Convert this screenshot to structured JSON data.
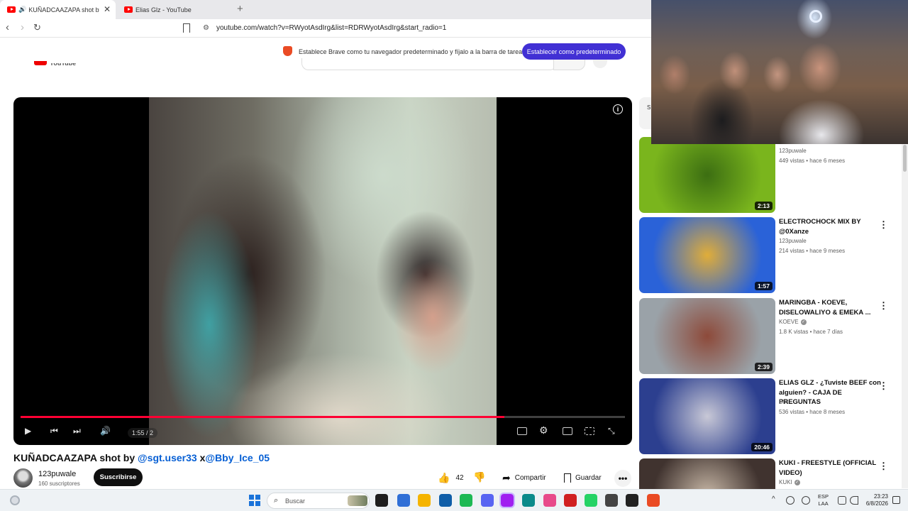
{
  "browser": {
    "tabs": [
      {
        "label": "KUÑADCAAZAPA shot by @s"
      },
      {
        "label": "Elias Glz - YouTube"
      }
    ],
    "close_tab_glyph": "✕",
    "new_tab_glyph": "+",
    "url": "youtube.com/watch?v=RWyotAsdIrg&list=RDRWyotAsdIrg&start_radio=1",
    "nav": {
      "back_glyph": "‹",
      "forward_glyph": "›",
      "reload_glyph": "↻"
    }
  },
  "banner": {
    "text": "Establece Brave como tu navegador predeterminado y fíjalo a la barra de tareas",
    "button_label": "Establecer como predeterminado"
  },
  "masthead": {
    "logo_partial_text": "YouTube"
  },
  "player": {
    "time_display": "1:55 / 2",
    "progress_fraction": 0.8,
    "info_glyph": "i",
    "controls": {
      "play": "▶",
      "prev": "⏮",
      "next": "⏭",
      "volume": "🔊"
    }
  },
  "video": {
    "title_prefix": "KUÑADCAAZAPA shot by ",
    "mention1": "@sgt.user33",
    "title_mid": " x",
    "mention2": "@Bby_Ice_05",
    "channel": "123puwale",
    "subscribers": "160 suscriptores",
    "subscribe_label": "Suscribirse",
    "likes": "42",
    "share_label": "Compartir",
    "save_label": "Guardar",
    "more_glyph": "•••"
  },
  "sidebar": {
    "partial_item_text": "S",
    "items": [
      {
        "title": "",
        "channel": "123puwale",
        "meta": "449 vistas • hace 6 meses",
        "duration": "2:13",
        "colors": [
          "#7ab51d",
          "#3c6e12"
        ]
      },
      {
        "title": "ELECTROCHOCK MIX BY @0Xanze",
        "channel": "123puwale",
        "meta": "214 vistas • hace 9 meses",
        "duration": "1:57",
        "colors": [
          "#2a62d8",
          "#e0ad39"
        ]
      },
      {
        "title": "MARINGBA - KOEVE, DISELOWALIYO & EMEKA ...",
        "channel": "KOEVE",
        "verified": true,
        "meta": "1.8 K vistas • hace 7 días",
        "duration": "2:39",
        "colors": [
          "#9aa2a8",
          "#8d4a3a"
        ]
      },
      {
        "title": "ELIAS GLZ - ¿Tuviste BEEF con alguien? - CAJA DE PREGUNTAS",
        "channel": "DIA",
        "meta": "536 vistas • hace 8 meses",
        "duration": "20:46",
        "colors": [
          "#2c3f8f",
          "#c8c8d6"
        ]
      },
      {
        "title": "KUKI - FREESTYLE (OFFICIAL VIDEO)",
        "channel": "KUKI",
        "verified": true,
        "meta": "",
        "duration": "",
        "colors": [
          "#40332f",
          "#c9b9a8"
        ]
      }
    ],
    "menu_glyph": "⋮"
  },
  "taskbar": {
    "search_label": "Buscar",
    "lang_line1": "ESP",
    "lang_line2": "LAA",
    "time": "23:23",
    "date": "6/8/2026",
    "app_colors": [
      "#1e1e1e",
      "#2f6fd6",
      "#f5b400",
      "#0f5ea8",
      "#1db954",
      "#5865f2",
      "#a020f0",
      "#0b8a8a",
      "#e84a8a",
      "#d02020",
      "#25d366",
      "#444444",
      "#222222",
      "#ea4b24"
    ]
  }
}
